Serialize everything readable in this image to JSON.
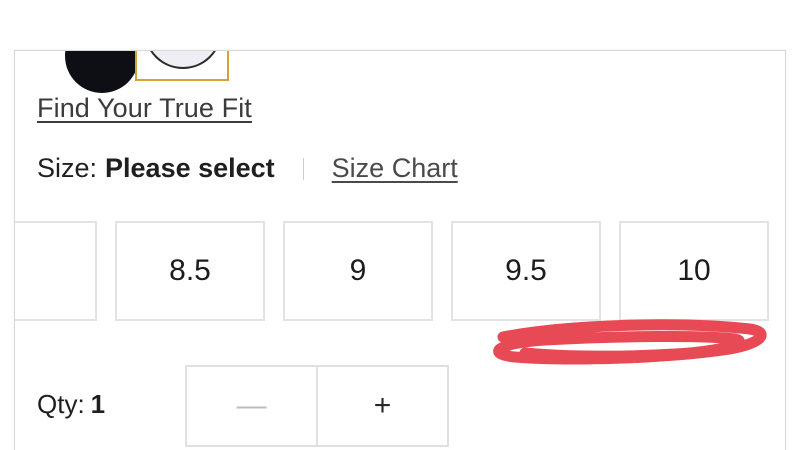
{
  "product": {
    "swatches": [
      {
        "name": "black",
        "color": "#0e0f14",
        "selected": false
      },
      {
        "name": "white",
        "color": "#eeeef4",
        "selected": true
      }
    ],
    "selected_swatch_border_color": "#d4a338",
    "find_fit_link": "Find Your True Fit",
    "size": {
      "label": "Size:",
      "value": "Please select",
      "chart_link": "Size Chart",
      "options": [
        "",
        "8.5",
        "9",
        "9.5",
        "10"
      ]
    },
    "quantity": {
      "label": "Qty:",
      "value": "1",
      "minus_label": "—",
      "plus_label": "+"
    },
    "annotation_color": "#e84a55"
  }
}
